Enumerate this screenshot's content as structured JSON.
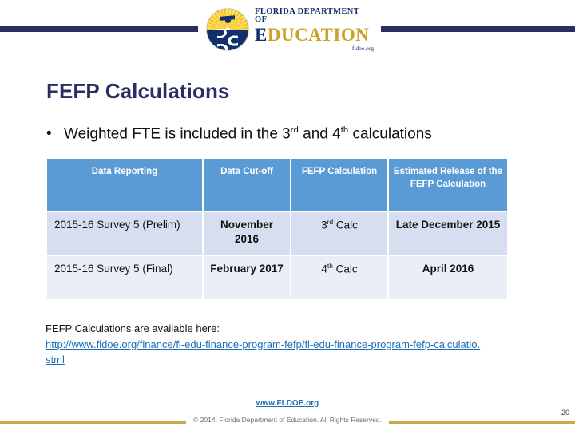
{
  "header": {
    "logo": {
      "line1": "FLORIDA DEPARTMENT OF",
      "line2_e": "E",
      "line2_rest": "DUCATION",
      "line3": "fldoe.org",
      "seal_icon": "fldoe-seal-icon"
    },
    "rule_color": "#2B2E63"
  },
  "title": "FEFP Calculations",
  "bullet": {
    "marker": "•",
    "prefix": "Weighted FTE is included in the 3",
    "sup1": "rd",
    "middle": " and 4",
    "sup2": "th",
    "suffix": " calculations"
  },
  "table": {
    "headers": [
      "Data Reporting",
      "Data Cut-off",
      "FEFP Calculation",
      "Estimated Release of the FEFP Calculation"
    ],
    "rows": [
      {
        "reporting": "2015-16 Survey 5 (Prelim)",
        "cutoff": "November 2016",
        "calc_num": "3",
        "calc_sup": "rd",
        "calc_word": " Calc",
        "release": "Late December 2015"
      },
      {
        "reporting": "2015-16 Survey 5 (Final)",
        "cutoff": "February 2017",
        "calc_num": "4",
        "calc_sup": "th",
        "calc_word": " Calc",
        "release": "April 2016"
      }
    ],
    "header_bg": "#5B9BD5",
    "row1_bg": "#D6DEEF",
    "row2_bg": "#EAEEF6"
  },
  "link_block": {
    "lead": "FEFP Calculations are available here:",
    "url": "http://www.fldoe.org/finance/fl-edu-finance-program-fefp/fl-edu-finance-program-fefp-calculatio.stml",
    "url_color": "#1F6FB5"
  },
  "footer": {
    "site": "www.FLDOE.org",
    "copyright": "© 2014, Florida Department of Education. All Rights Reserved.",
    "page_number": "20",
    "rule_color": "#C9A94E"
  }
}
